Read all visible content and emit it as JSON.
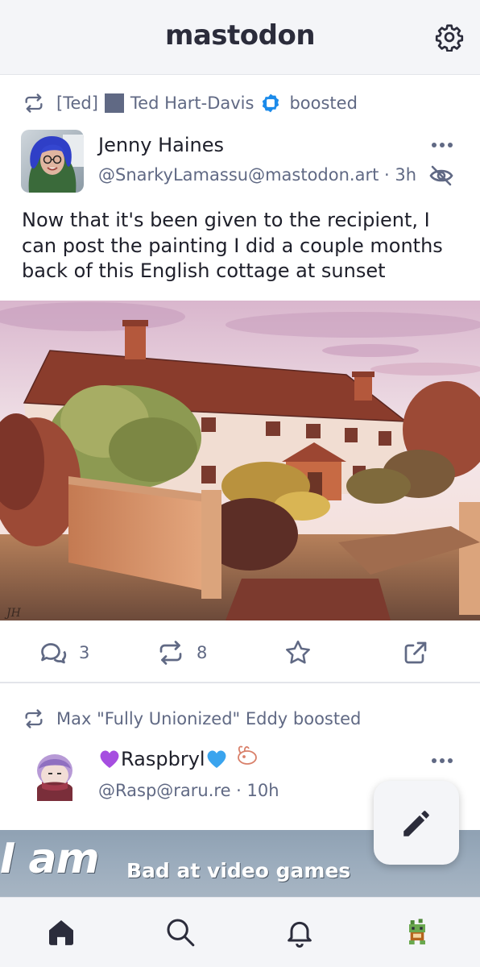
{
  "app": {
    "brand": "mastodon"
  },
  "header": {
    "settings_icon": "gear-icon"
  },
  "post1": {
    "boost": {
      "prefix": "[Ted]",
      "name": "Ted Hart-Davis",
      "suffix": "boosted"
    },
    "author": {
      "display_name": "Jenny Haines",
      "handle": "@SnarkyLamassu@mastodon.art",
      "time": "3h"
    },
    "text": "Now that it's been given to the recipient, I can post the painting I did a couple months back of this English cottage at sunset",
    "signature": "JH",
    "actions": {
      "replies": "3",
      "boosts": "8"
    }
  },
  "post2": {
    "boost": {
      "line": "Max \"Fully Unionized\" Eddy boosted"
    },
    "author": {
      "display_name": "Raspbryl",
      "handle": "@Rasp@raru.re",
      "time": "10h"
    },
    "media_text_big": "I am",
    "media_text_small": "Bad at video games"
  },
  "colors": {
    "accent": "#6364ff",
    "muted": "#606984",
    "text": "#1e1f2a",
    "header_bg": "#f4f5f8"
  }
}
